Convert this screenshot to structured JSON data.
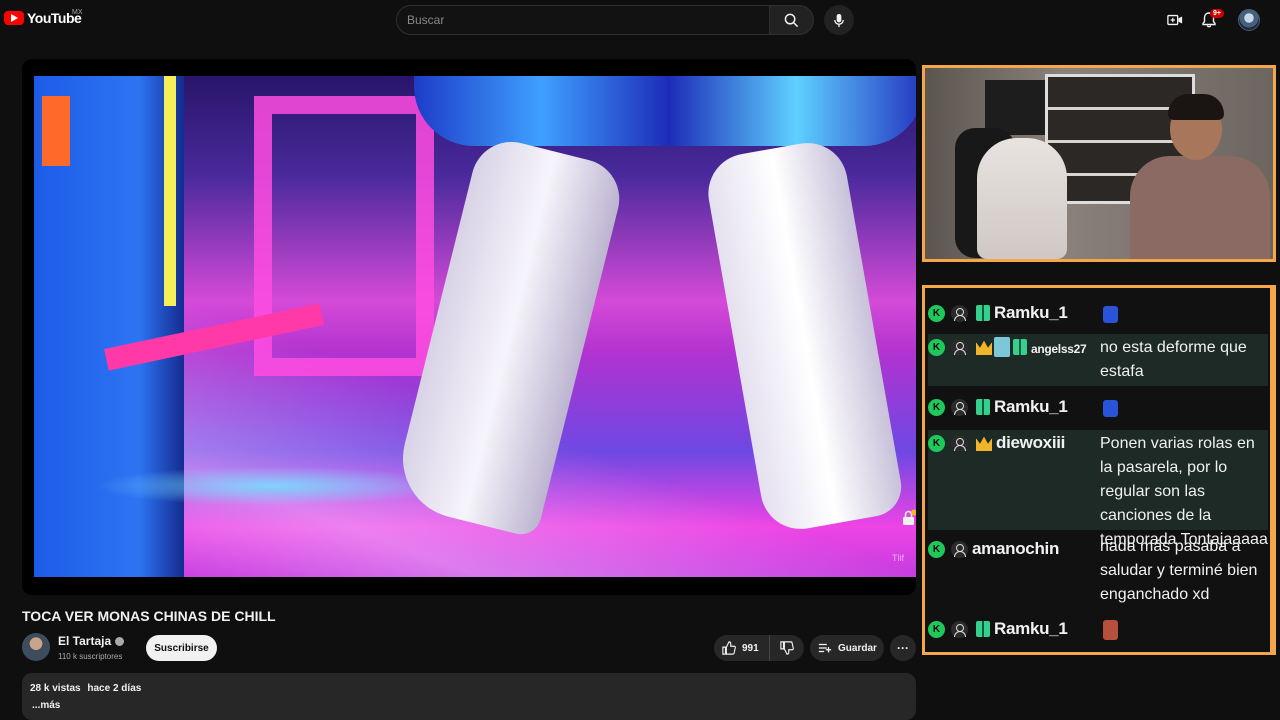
{
  "header": {
    "logo_text": "YouTube",
    "country": "MX",
    "search_placeholder": "Buscar",
    "notifications_badge": "9+"
  },
  "video": {
    "watermark": "Tlif",
    "title": "TOCA VER MONAS CHINAS DE CHILL",
    "channel": "El Tartaja",
    "subscribers": "110 k suscriptores",
    "subscribe_label": "Suscribirse",
    "likes": "991",
    "save_label": "Guardar",
    "more_label": "···",
    "views": "28 k vistas",
    "posted": "hace 2 días",
    "more_desc": "...más"
  },
  "chat": {
    "messages": [
      {
        "user": "Ramku_1",
        "text": "",
        "emote": "blue-emote"
      },
      {
        "user": "angelss27",
        "text": "no esta deforme que estafa"
      },
      {
        "user": "Ramku_1",
        "text": "",
        "emote": "blue-emote"
      },
      {
        "user": "diewoxiii",
        "text": "Ponen varias rolas en la pasarela, por lo regular son las canciones de la temporada Tontajaaaaa"
      },
      {
        "user": "amanochin",
        "text": "nada más pasaba a saludar y terminé bien enganchado xd"
      },
      {
        "user": "Ramku_1",
        "text": "",
        "emote": "red-emote"
      }
    ]
  },
  "colors": {
    "accent_orange": "#f5a54a",
    "yt_red": "#ff0000",
    "chat_badge_green": "#1ec85a"
  }
}
